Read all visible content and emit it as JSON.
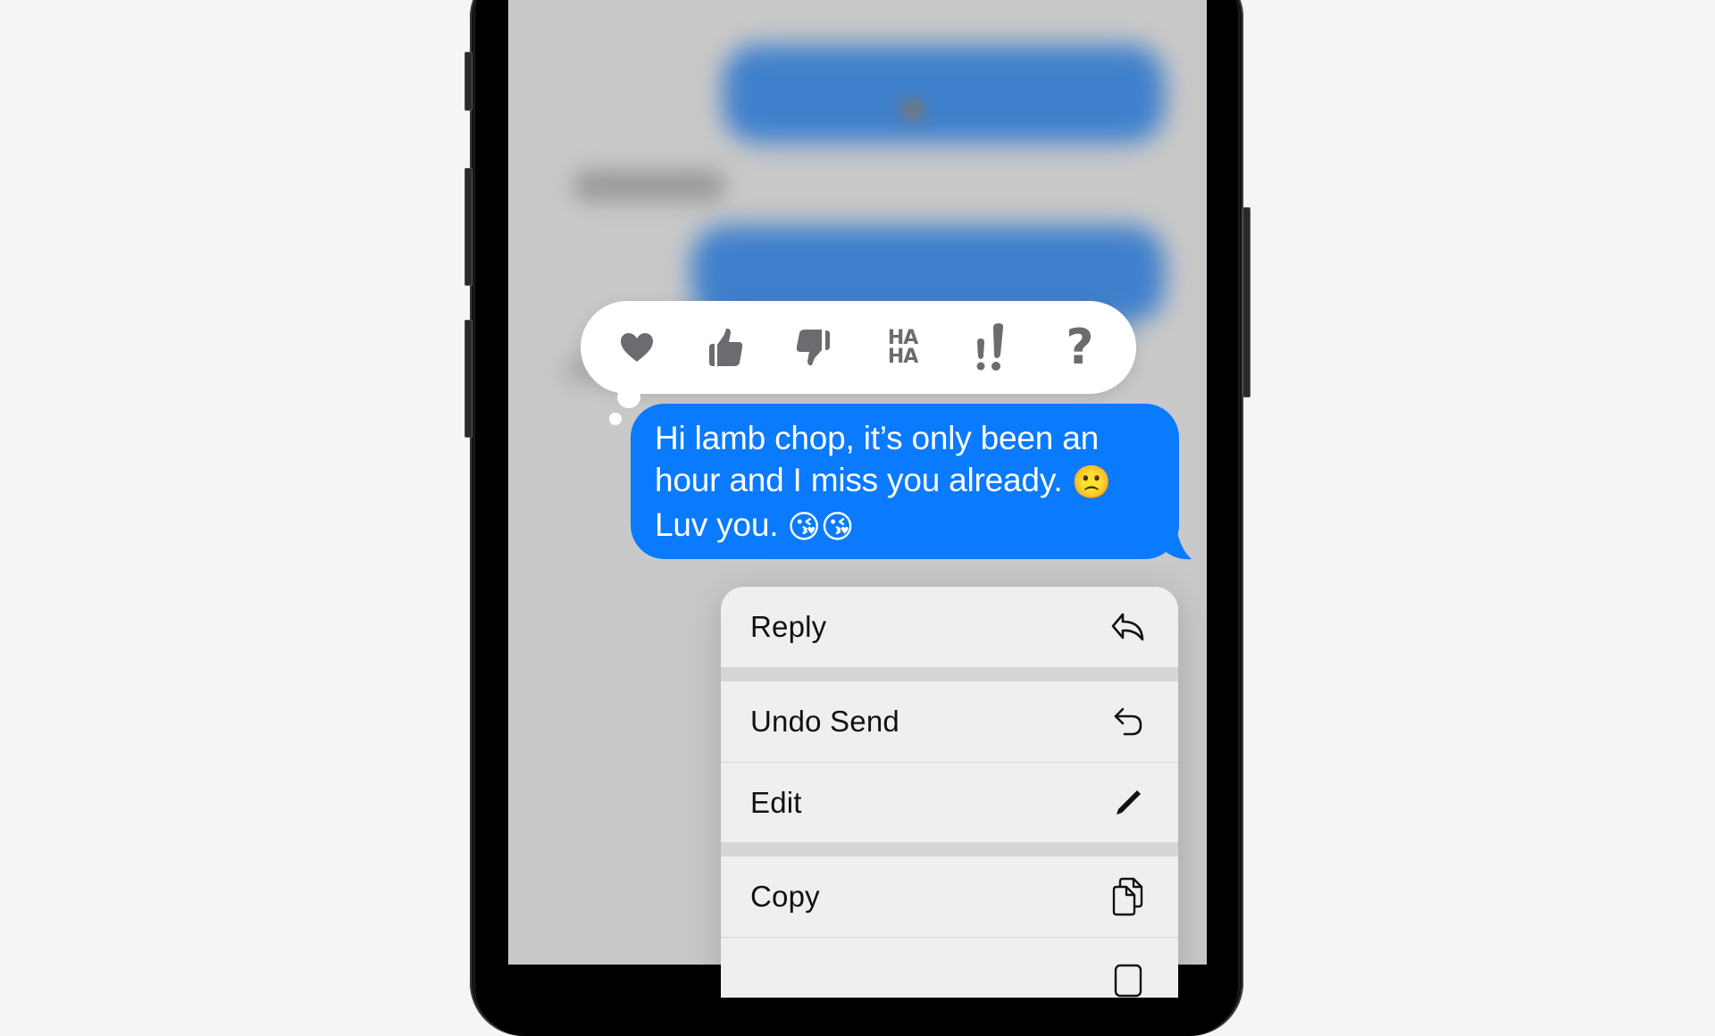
{
  "app": "Messages",
  "colors": {
    "bubble_blue": "#0a7aff",
    "tapback_icon": "#6c6c70",
    "menu_bg": "#efeff1",
    "dim_background": "#c9c9c9"
  },
  "tapbacks": [
    {
      "name": "heart",
      "icon": "heart-icon"
    },
    {
      "name": "thumbs-up",
      "icon": "thumbs-up-icon"
    },
    {
      "name": "thumbs-down",
      "icon": "thumbs-down-icon"
    },
    {
      "name": "haha",
      "icon": "haha-icon",
      "label_top": "HA",
      "label_bottom": "HA"
    },
    {
      "name": "emphasize",
      "icon": "double-exclamation-icon",
      "label": "!!"
    },
    {
      "name": "question",
      "icon": "question-icon",
      "label": "?"
    }
  ],
  "message": {
    "lines": [
      "Hi lamb chop, it’s only been an",
      "hour and I miss you already.",
      "Luv you."
    ],
    "emoji_line2": "🙁",
    "emoji_line3a": "😘",
    "emoji_line3b": "😘"
  },
  "context_menu": {
    "items": [
      {
        "label": "Reply",
        "icon": "reply-icon"
      },
      {
        "label": "Undo Send",
        "icon": "undo-icon"
      },
      {
        "label": "Edit",
        "icon": "pencil-icon"
      },
      {
        "label": "Copy",
        "icon": "copy-icon"
      },
      {
        "label": "",
        "icon": "partially-visible-icon"
      }
    ]
  }
}
